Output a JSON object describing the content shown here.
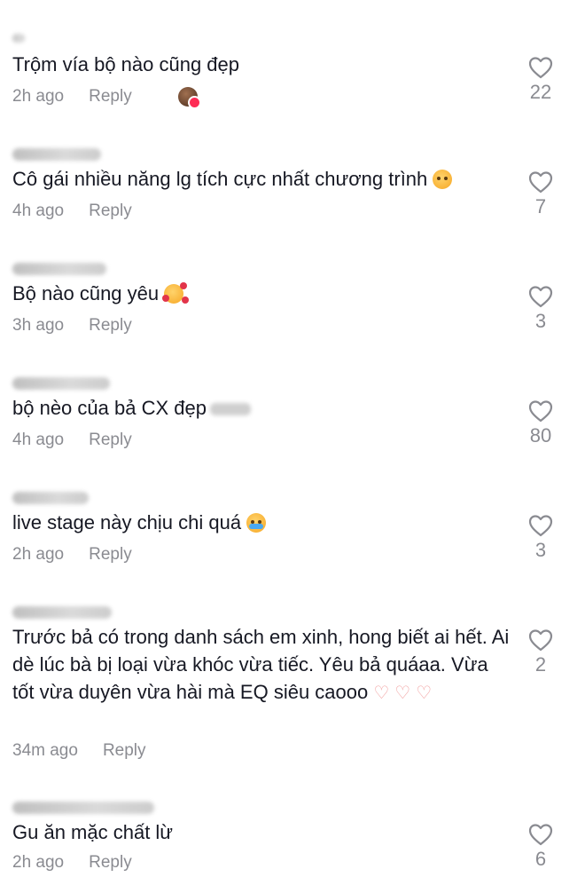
{
  "comments": [
    {
      "text": "Trộm vía bộ nào cũng đẹp",
      "time": "2h ago",
      "reply": "Reply",
      "likes": "22",
      "emoji": "",
      "creator_liked": true
    },
    {
      "text": "Cô gái nhiều năng lg tích cực nhất chương trình",
      "time": "4h ago",
      "reply": "Reply",
      "likes": "7",
      "emoji": "worried-face"
    },
    {
      "text": "Bộ nào cũng yêu",
      "time": "3h ago",
      "reply": "Reply",
      "likes": "3",
      "emoji": "smiling-face-with-hearts"
    },
    {
      "text": "bộ nèo của bả CX đẹp",
      "time": "4h ago",
      "reply": "Reply",
      "likes": "80",
      "emoji": ""
    },
    {
      "text": "live stage này chịu chi quá",
      "time": "2h ago",
      "reply": "Reply",
      "likes": "3",
      "emoji": "loudly-crying-face"
    },
    {
      "text": "Trước bả có trong danh sách em xinh, hong biết ai hết. Ai dè lúc bà bị loại vừa khóc vừa tiếc. Yêu bả quáaa. Vừa tốt vừa duyên vừa hài mà EQ siêu caooo",
      "time": "34m ago",
      "reply": "Reply",
      "likes": "2",
      "emoji": "heart-hands"
    },
    {
      "text": "Gu ăn mặc chất lừ",
      "time": "2h ago",
      "reply": "Reply",
      "likes": "6",
      "emoji": ""
    }
  ],
  "colors": {
    "text": "#161823",
    "meta": "#8a8b91",
    "accent": "#fe2c55"
  },
  "icons": {
    "like": "heart-outline-icon"
  }
}
